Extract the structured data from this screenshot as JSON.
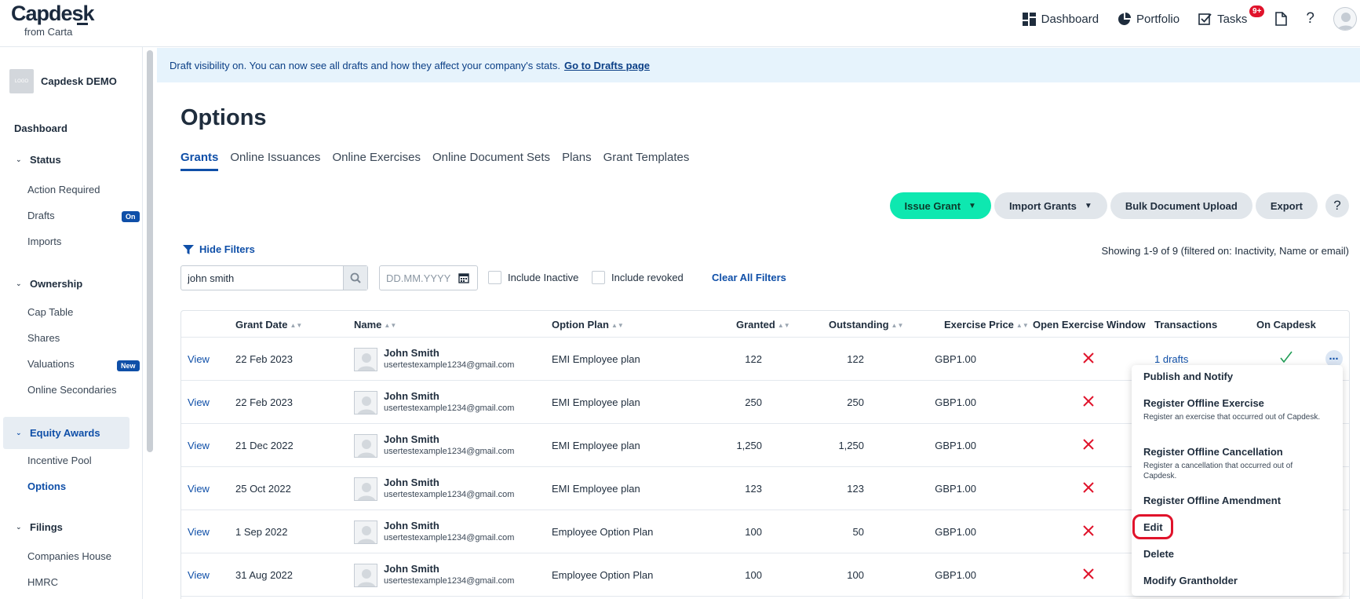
{
  "brand": {
    "name": "Capdesk",
    "sub": "from Carta"
  },
  "topnav": {
    "dashboard": "Dashboard",
    "portfolio": "Portfolio",
    "tasks": "Tasks",
    "tasks_badge": "9+",
    "help": "?"
  },
  "sidebar": {
    "company_logo": "LOGO",
    "company_name": "Capdesk DEMO",
    "dashboard": "Dashboard",
    "status": "Status",
    "action_required": "Action Required",
    "drafts": "Drafts",
    "drafts_pill": "On",
    "imports": "Imports",
    "ownership": "Ownership",
    "cap_table": "Cap Table",
    "shares": "Shares",
    "valuations": "Valuations",
    "valuations_pill": "New",
    "online_secondaries": "Online Secondaries",
    "equity_awards": "Equity Awards",
    "incentive_pool": "Incentive Pool",
    "options": "Options",
    "filings": "Filings",
    "companies_house": "Companies House",
    "hmrc": "HMRC"
  },
  "banner": {
    "text": "Draft visibility on. You can now see all drafts and how they affect your company's stats.",
    "link": "Go to Drafts page"
  },
  "page": {
    "title": "Options",
    "tabs": [
      "Grants",
      "Online Issuances",
      "Online Exercises",
      "Online Document Sets",
      "Plans",
      "Grant Templates"
    ]
  },
  "actions": {
    "issue_grant": "Issue Grant",
    "import_grants": "Import Grants",
    "bulk_upload": "Bulk Document Upload",
    "export": "Export",
    "help": "?"
  },
  "filters": {
    "toggle": "Hide Filters",
    "search_value": "john smith",
    "date_placeholder": "DD.MM.YYYY",
    "include_inactive": "Include Inactive",
    "include_revoked": "Include revoked",
    "clear": "Clear All Filters",
    "showing": "Showing 1-9 of 9 (filtered on: Inactivity, Name or email)"
  },
  "table": {
    "headers": {
      "grant_date": "Grant Date",
      "name": "Name",
      "option_plan": "Option Plan",
      "granted": "Granted",
      "outstanding": "Outstanding",
      "exercise_price": "Exercise Price",
      "open_window": "Open Exercise Window",
      "transactions": "Transactions",
      "on_capdesk": "On Capdesk"
    },
    "view_label": "View",
    "rows": [
      {
        "date": "22 Feb 2023",
        "name": "John Smith",
        "email": "usertestexample1234@gmail.com",
        "plan": "EMI Employee plan",
        "granted": "122",
        "outstanding": "122",
        "price": "GBP1.00",
        "transactions": "1 drafts"
      },
      {
        "date": "22 Feb 2023",
        "name": "John Smith",
        "email": "usertestexample1234@gmail.com",
        "plan": "EMI Employee plan",
        "granted": "250",
        "outstanding": "250",
        "price": "GBP1.00"
      },
      {
        "date": "21 Dec 2022",
        "name": "John Smith",
        "email": "usertestexample1234@gmail.com",
        "plan": "EMI Employee plan",
        "granted": "1,250",
        "outstanding": "1,250",
        "price": "GBP1.00"
      },
      {
        "date": "25 Oct 2022",
        "name": "John Smith",
        "email": "usertestexample1234@gmail.com",
        "plan": "EMI Employee plan",
        "granted": "123",
        "outstanding": "123",
        "price": "GBP1.00"
      },
      {
        "date": "1 Sep 2022",
        "name": "John Smith",
        "email": "usertestexample1234@gmail.com",
        "plan": "Employee Option Plan",
        "granted": "100",
        "outstanding": "50",
        "price": "GBP1.00"
      },
      {
        "date": "31 Aug 2022",
        "name": "John Smith",
        "email": "usertestexample1234@gmail.com",
        "plan": "Employee Option Plan",
        "granted": "100",
        "outstanding": "100",
        "price": "GBP1.00"
      }
    ]
  },
  "menu": {
    "publish": "Publish and Notify",
    "offline_exercise": "Register Offline Exercise",
    "offline_exercise_desc": "Register an exercise that occurred out of Capdesk.",
    "offline_cancellation": "Register Offline Cancellation",
    "offline_cancellation_desc": "Register a cancellation that occurred out of Capdesk.",
    "offline_amendment": "Register Offline Amendment",
    "edit": "Edit",
    "delete": "Delete",
    "modify": "Modify Grantholder"
  },
  "colors": {
    "accent": "#0f4fa8",
    "primary_button": "#0ee8b0",
    "danger": "#e0132b",
    "success": "#1f9d55"
  }
}
